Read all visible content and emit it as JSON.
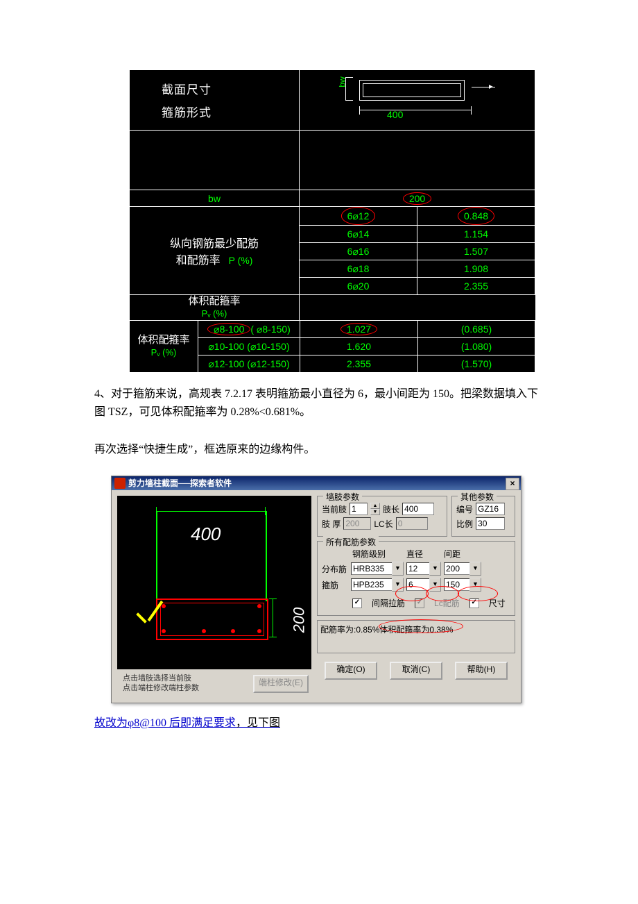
{
  "cad": {
    "header_l1": "截面尺寸",
    "header_l2": "箍筋形式",
    "dim_400": "400",
    "bw_label": "bw",
    "bw_val": "200",
    "longit_l1": "纵向钢筋最少配筋",
    "longit_l2": "和配筋率",
    "p_pct": "P (%)",
    "rows": [
      {
        "bar": "6⌀12",
        "val": "0.848"
      },
      {
        "bar": "6⌀14",
        "val": "1.154"
      },
      {
        "bar": "6⌀16",
        "val": "1.507"
      },
      {
        "bar": "6⌀18",
        "val": "1.908"
      },
      {
        "bar": "6⌀20",
        "val": "2.355"
      }
    ],
    "vol_l1": "体积配箍率",
    "vol_pv": "Pᵥ (%)",
    "vol_rows": [
      {
        "a": "⌀8-100",
        "b": "( ⌀8-150)",
        "v1": "1.027",
        "v2": "(0.685)"
      },
      {
        "a": "⌀10-100",
        "b": "(⌀10-150)",
        "v1": "1.620",
        "v2": "(1.080)"
      },
      {
        "a": "⌀12-100",
        "b": "(⌀12-150)",
        "v1": "2.355",
        "v2": "(1.570)"
      }
    ]
  },
  "para4_num": "4、",
  "para4": "对于箍筋来说，高规表 7.2.17 表明箍筋最小直径为 6，最小间距为 150。把梁数据填入下图 TSZ，可见体积配箍率为 0.28%<0.681%。",
  "para_again": "再次选择“快捷生成”，框选原来的边缘构件。",
  "dlg": {
    "title": "剪力墙柱截面──探索者软件",
    "close": "×",
    "pv_400": "400",
    "pv_200": "200",
    "hint1": "点击墙肢选择当前肢",
    "hint2": "点击端柱修改端柱参数",
    "btn_mod": "端柱修改(E)",
    "fs1": "墙肢参数",
    "lbl_curlimb": "当前肢",
    "val_curlimb": "1",
    "lbl_limblen": "肢长",
    "val_limblen": "400",
    "lbl_thick": "肢  厚",
    "val_thick": "200",
    "lbl_lclen": "LC长",
    "val_lclen": "0",
    "fs2": "其他参数",
    "lbl_code": "编号",
    "val_code": "GZ16",
    "lbl_scale": "比例",
    "val_scale": "30",
    "fs3": "所有配筋参数",
    "col_grade": "钢筋级别",
    "col_dia": "直径",
    "col_space": "间距",
    "lbl_dist": "分布筋",
    "dist_grade": "HRB335",
    "dist_dia": "12",
    "dist_space": "200",
    "lbl_stir": "箍筋",
    "stir_grade": "HPB235",
    "stir_dia": "6",
    "stir_space": "150",
    "chk1": "间隔拉筋",
    "chk2": "Lc配筋",
    "chk3": "尺寸",
    "ratio": "配筋率为:0.85%",
    "ratio2": "体积配箍率为0.38%",
    "ok": "确定(O)",
    "cancel": "取消(C)",
    "help": "帮助(H)"
  },
  "footlink": "故改为φ8@100 后即满足要求",
  "foottail": "，见下图"
}
